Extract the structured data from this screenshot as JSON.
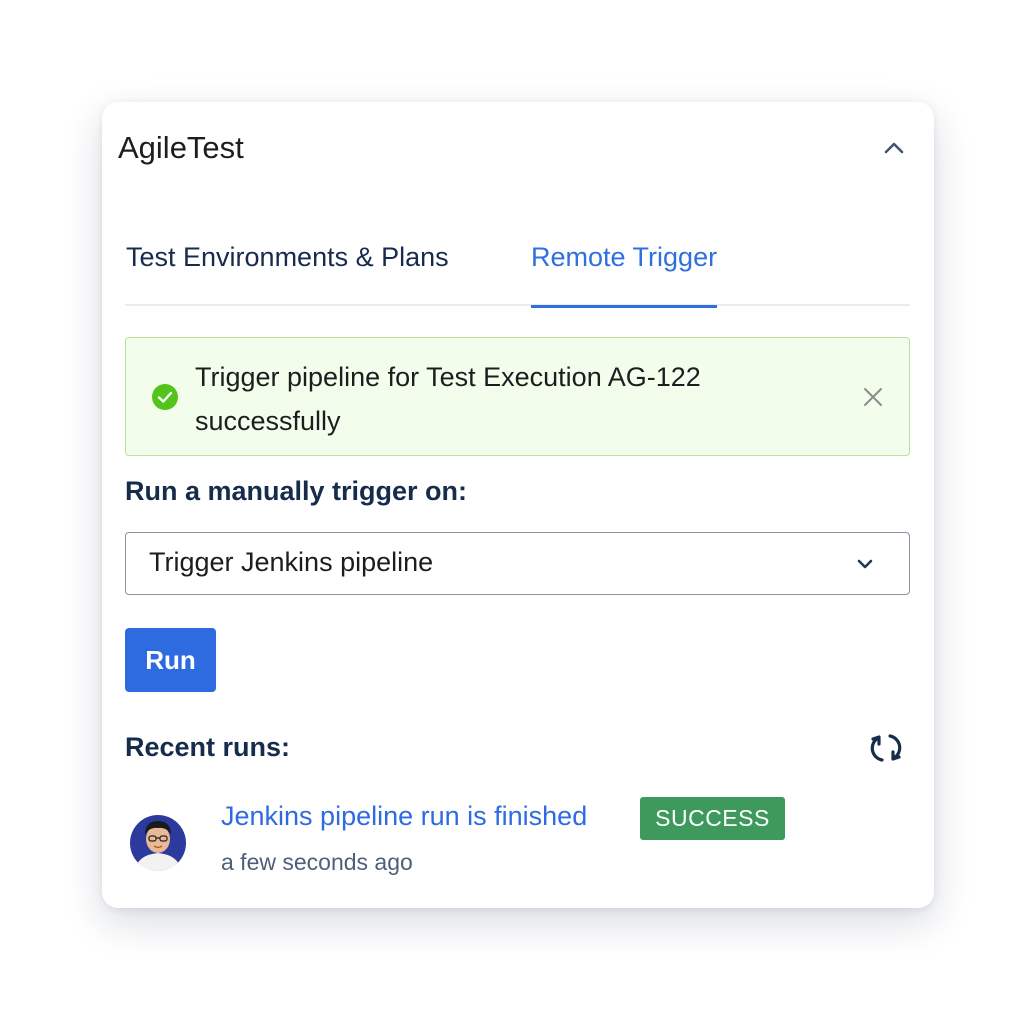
{
  "panel": {
    "title": "AgileTest"
  },
  "tabs": [
    {
      "label": "Test Environments & Plans",
      "active": false
    },
    {
      "label": "Remote Trigger",
      "active": true
    }
  ],
  "alert": {
    "message": "Trigger pipeline for Test Execution AG-122 successfully",
    "type": "success",
    "icon": "check-circle-icon"
  },
  "trigger": {
    "label": "Run a manually trigger on:",
    "selected": "Trigger Jenkins pipeline",
    "run_label": "Run"
  },
  "recent": {
    "label": "Recent runs:",
    "runs": [
      {
        "title": "Jenkins pipeline run is finished",
        "status": "SUCCESS",
        "time": "a few seconds ago"
      }
    ]
  },
  "colors": {
    "accent": "#2f6be0",
    "success_badge": "#3d9a5c",
    "alert_bg": "#f3fdec",
    "alert_border": "#b7e39c"
  }
}
